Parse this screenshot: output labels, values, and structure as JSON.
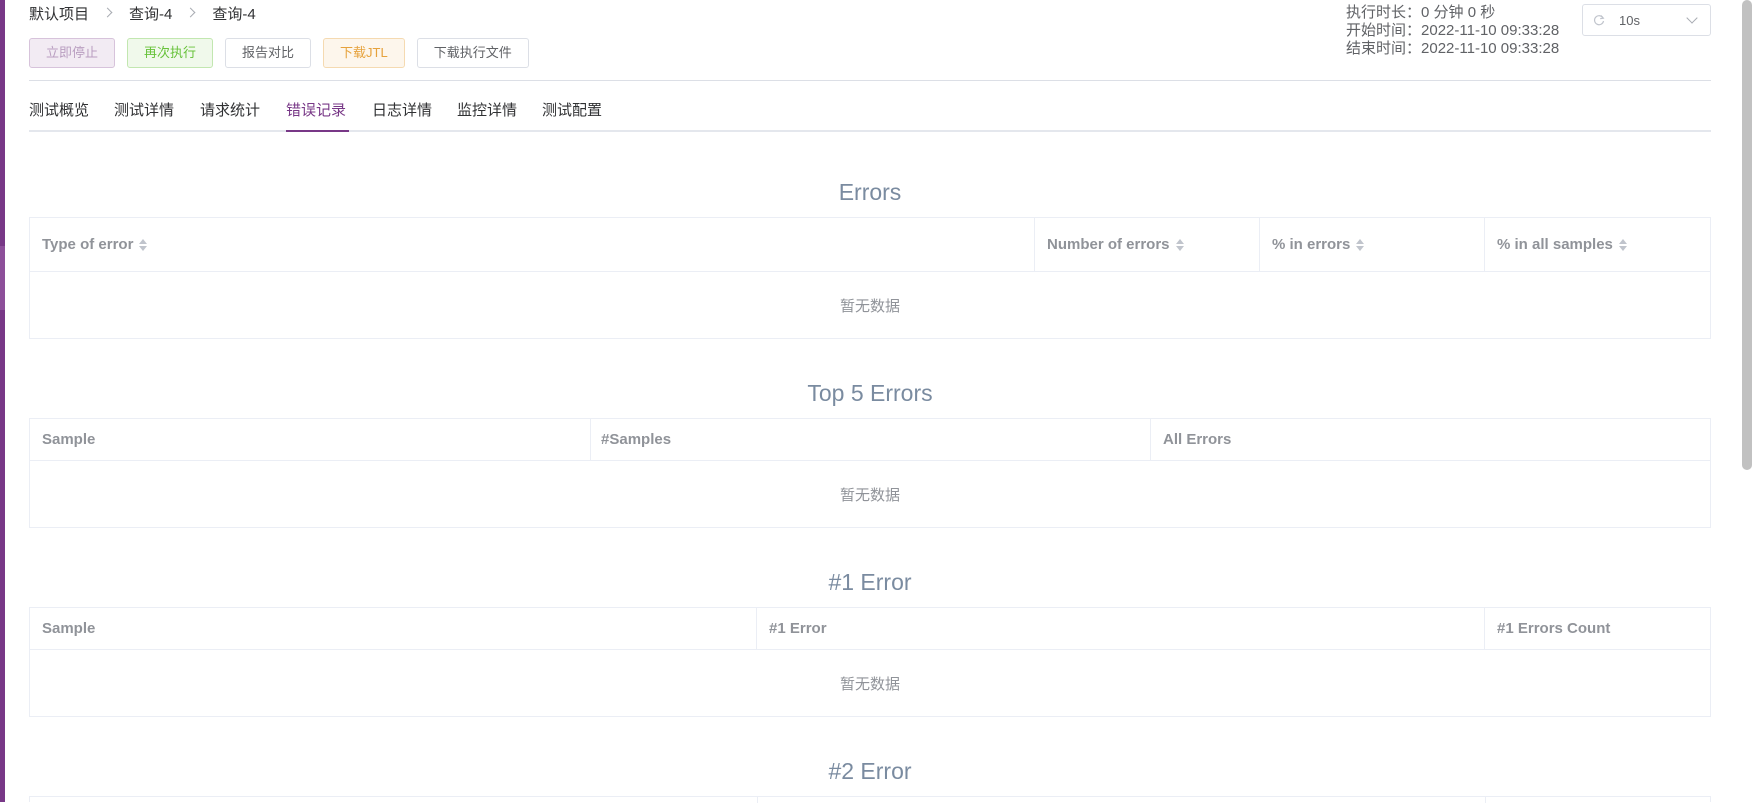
{
  "breadcrumb": [
    "默认项目",
    "查询-4",
    "查询-4"
  ],
  "toolbar": {
    "stop_label": "立即停止",
    "rerun_label": "再次执行",
    "compare_label": "报告对比",
    "download_jtl_label": "下载JTL",
    "download_files_label": "下载执行文件"
  },
  "meta": {
    "duration_label": "执行时长：",
    "duration_value": "0 分钟 0 秒",
    "start_label": "开始时间：",
    "start_value": "2022-11-10 09:33:28",
    "end_label": "结束时间：",
    "end_value": "2022-11-10 09:33:28"
  },
  "refresh": {
    "icon": "refresh-icon",
    "value": "10s"
  },
  "tabs": [
    {
      "label": "测试概览"
    },
    {
      "label": "测试详情"
    },
    {
      "label": "请求统计"
    },
    {
      "label": "错误记录",
      "active": true
    },
    {
      "label": "日志详情"
    },
    {
      "label": "监控详情"
    },
    {
      "label": "测试配置"
    }
  ],
  "sections": {
    "errors": {
      "title": "Errors",
      "columns": [
        "Type of error",
        "Number of errors",
        "% in errors",
        "% in all samples"
      ],
      "empty_text": "暂无数据"
    },
    "top5": {
      "title": "Top 5 Errors",
      "columns": [
        "Sample",
        "#Samples",
        "All Errors"
      ],
      "empty_text": "暂无数据"
    },
    "error1": {
      "title": "#1 Error",
      "columns": [
        "Sample",
        "#1 Error",
        "#1 Errors Count"
      ],
      "empty_text": "暂无数据"
    },
    "error2": {
      "title": "#2 Error"
    }
  },
  "colors": {
    "accent": "#783887",
    "title": "#7a8ba0",
    "border": "#ebeef5"
  }
}
